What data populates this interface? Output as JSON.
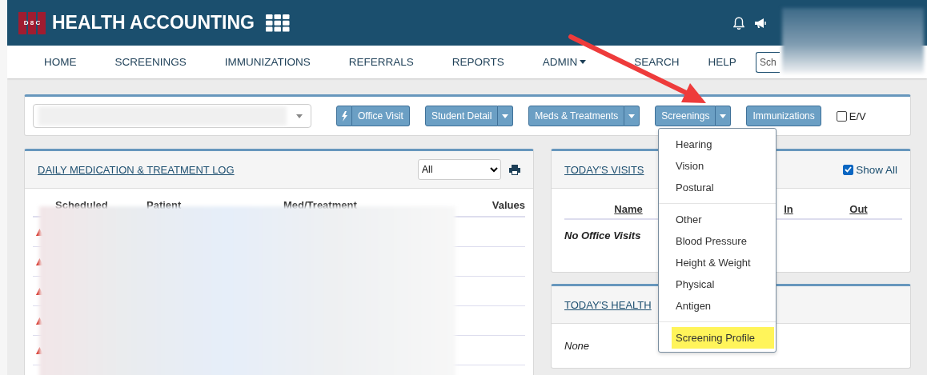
{
  "header": {
    "logo_text": "D 8 C",
    "title": "HEALTH ACCOUNTING"
  },
  "nav": {
    "items": [
      {
        "label": "HOME",
        "dropdown": false
      },
      {
        "label": "SCREENINGS",
        "dropdown": false
      },
      {
        "label": "IMMUNIZATIONS",
        "dropdown": false
      },
      {
        "label": "REFERRALS",
        "dropdown": false
      },
      {
        "label": "REPORTS",
        "dropdown": false
      },
      {
        "label": "ADMIN",
        "dropdown": true
      },
      {
        "label": "SEARCH",
        "dropdown": false
      },
      {
        "label": "HELP",
        "dropdown": false
      }
    ],
    "search": {
      "placeholder": "Sch"
    }
  },
  "toolbar": {
    "buttons": [
      {
        "label": "Office Visit",
        "kind": "icon"
      },
      {
        "label": "Student Detail",
        "kind": "split"
      },
      {
        "label": "Meds & Treatments",
        "kind": "split"
      },
      {
        "label": "Screenings",
        "kind": "split"
      },
      {
        "label": "Immunizations",
        "kind": "plain"
      }
    ],
    "ev": {
      "label": "E/V",
      "checked": false
    }
  },
  "med_log": {
    "title": "DAILY MEDICATION & TREATMENT LOG",
    "filter": "All",
    "columns": [
      "Scheduled",
      "Patient",
      "Med/Treatment",
      "Values"
    ],
    "rows": [
      {
        "flagged": true
      },
      {
        "flagged": true
      },
      {
        "flagged": true
      },
      {
        "flagged": true
      },
      {
        "flagged": true
      }
    ]
  },
  "visits": {
    "title": "TODAY'S VISITS",
    "show_all": {
      "label": "Show All",
      "checked": true
    },
    "columns": [
      "Name",
      "In",
      "Out"
    ],
    "empty": "No Office Visits"
  },
  "health": {
    "title": "TODAY'S HEALTH",
    "empty": "None"
  },
  "screenings_menu": {
    "groups": [
      [
        {
          "label": "Hearing",
          "highlighted": false
        },
        {
          "label": "Vision",
          "highlighted": false
        },
        {
          "label": "Postural",
          "highlighted": false
        }
      ],
      [
        {
          "label": "Other",
          "highlighted": false
        },
        {
          "label": "Blood Pressure",
          "highlighted": false
        },
        {
          "label": "Height & Weight",
          "highlighted": false
        },
        {
          "label": "Physical",
          "highlighted": false
        },
        {
          "label": "Antigen",
          "highlighted": false
        }
      ],
      [
        {
          "label": "Screening Profile",
          "highlighted": true
        }
      ]
    ]
  }
}
